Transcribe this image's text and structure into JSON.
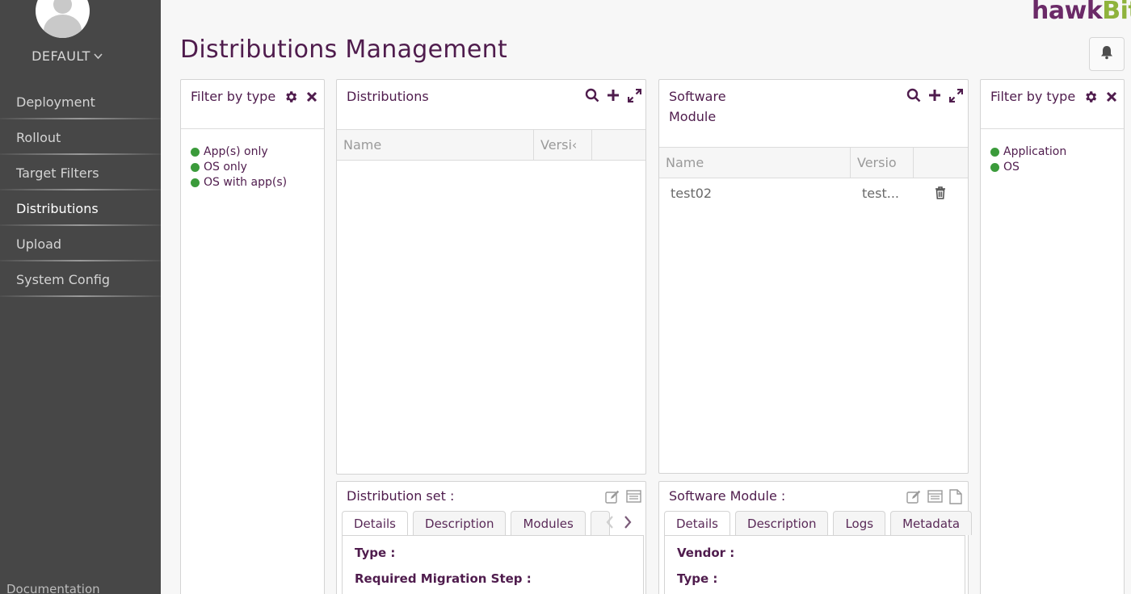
{
  "sidebar": {
    "tenant": "DEFAULT",
    "items": [
      {
        "label": "Deployment"
      },
      {
        "label": "Rollout"
      },
      {
        "label": "Target Filters"
      },
      {
        "label": "Distributions"
      },
      {
        "label": "Upload"
      },
      {
        "label": "System Config"
      }
    ],
    "active": "Distributions",
    "documentation": "Documentation"
  },
  "header": {
    "title": "Distributions Management",
    "logo_part1": "hawk",
    "logo_part2": "Bit"
  },
  "left_filter": {
    "title": "Filter by type",
    "items": [
      "App(s) only",
      "OS only",
      "OS with app(s)"
    ]
  },
  "distributions": {
    "title": "Distributions",
    "columns": [
      "Name",
      "Versi‹"
    ]
  },
  "software_module": {
    "title": "Software Module",
    "columns": [
      "Name",
      "Versio"
    ],
    "rows": [
      {
        "name": "test02",
        "version": "test..."
      }
    ]
  },
  "right_filter": {
    "title": "Filter by type",
    "items": [
      "Application",
      "OS"
    ]
  },
  "dist_details": {
    "title": "Distribution set :",
    "tabs": [
      "Details",
      "Description",
      "Modules"
    ],
    "fields": [
      "Type :",
      "Required Migration Step :"
    ]
  },
  "sm_details": {
    "title": "Software Module :",
    "tabs": [
      "Details",
      "Description",
      "Logs",
      "Metadata"
    ],
    "fields": [
      "Vendor :",
      "Type :"
    ]
  },
  "colors": {
    "accent": "#4f1c4d",
    "status_green": "#3b9b3b",
    "sidebar_bg": "#474747"
  }
}
